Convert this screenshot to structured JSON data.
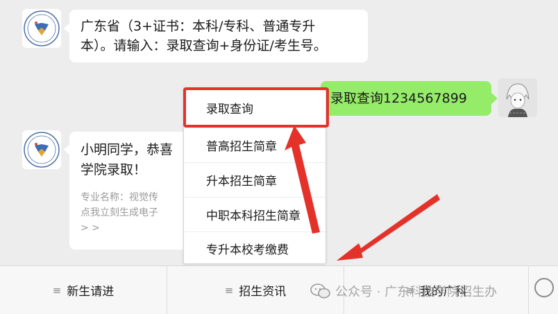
{
  "chat": {
    "msg1": {
      "line1": "广东省（3+证书：本科/专科、普通专升",
      "line2": "本）。请输入：录取查询+身份证/考生号。"
    },
    "msg_user": "录取查询1234567899",
    "card": {
      "title_line1": "小明同学，恭喜",
      "title_line2": "学院录取！",
      "desc_line1": "专业名称：视觉传",
      "desc_line2": "点我立刻生成电子",
      "desc_line3": "> >"
    }
  },
  "popup": {
    "items": [
      "录取查询",
      "普高招生简章",
      "升本招生简章",
      "中职本科招生简章",
      "专升本校考缴费"
    ]
  },
  "menu": {
    "items": [
      "新生请进",
      "招生资讯",
      "我的广科"
    ]
  },
  "watermark": "公众号 · 广东科技学院招生办",
  "colors": {
    "user_bubble": "#95ec69",
    "highlight_red": "#e4322b",
    "background": "#ededed"
  }
}
